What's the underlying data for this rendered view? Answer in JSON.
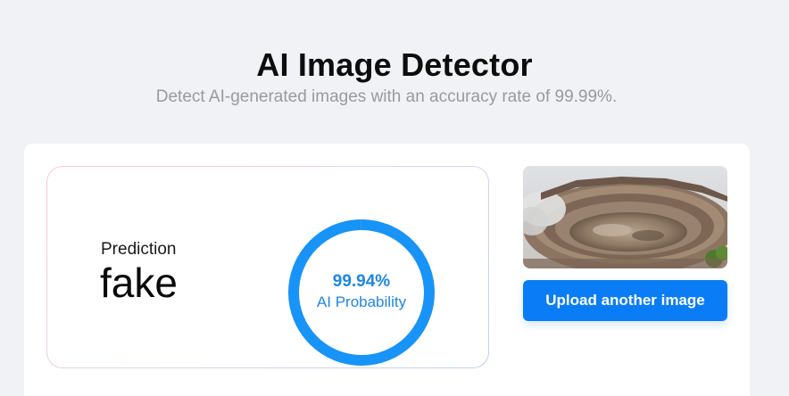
{
  "header": {
    "title": "AI Image Detector",
    "subtitle": "Detect AI-generated images with an accuracy rate of 99.99%."
  },
  "result": {
    "prediction_label": "Prediction",
    "prediction_value": "fake",
    "probability_text": "99.94%",
    "probability_fraction": 0.9994,
    "probability_caption": "AI Probability"
  },
  "preview": {
    "icon": "uploaded-image-thumbnail"
  },
  "actions": {
    "upload_label": "Upload another image"
  },
  "colors": {
    "background": "#f1f2f6",
    "accent": "#0a7df6",
    "ring": "#1893f8",
    "probability_text": "#1e86e6"
  }
}
